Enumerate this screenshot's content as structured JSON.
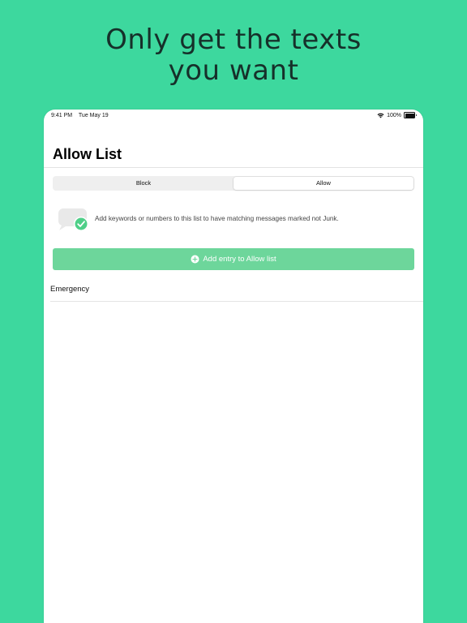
{
  "headline": {
    "line1": "Only get the texts",
    "line2": "you want"
  },
  "status_bar": {
    "time": "9:41 PM",
    "date": "Tue May 19",
    "battery": "100%",
    "icons": [
      "wifi-icon",
      "battery-icon"
    ]
  },
  "nav": {
    "title": "Allow List"
  },
  "segmented_control": {
    "options": [
      "Block",
      "Allow"
    ],
    "selected": "Allow"
  },
  "info": {
    "icon": "message-check-icon",
    "text": "Add keywords or numbers to this list to have matching messages marked not Junk."
  },
  "add_button": {
    "label": "Add entry to Allow list",
    "icon": "plus-circle-icon"
  },
  "list": {
    "items": [
      "Emergency"
    ]
  },
  "colors": {
    "background": "#3dd89e",
    "button": "#6dd69b",
    "check_badge": "#4fcf88"
  }
}
